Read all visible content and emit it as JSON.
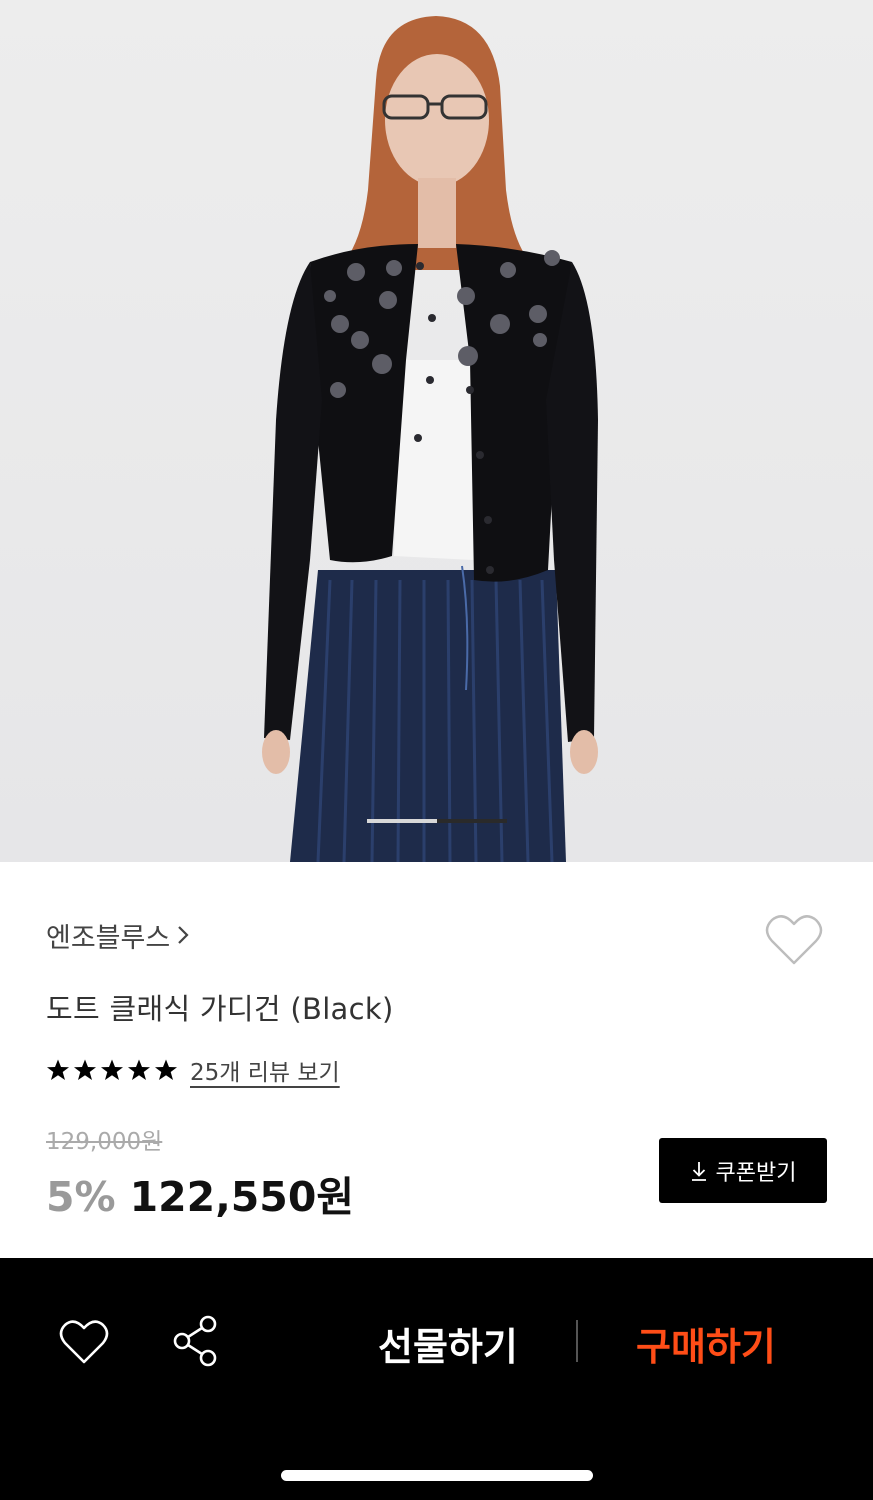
{
  "hero": {
    "image_alt": "",
    "carousel": {
      "active_index": 1,
      "total": 2
    }
  },
  "product": {
    "brand": "엔조블루스",
    "title": "도트 클래식 가디건 (Black)",
    "rating_stars": 5,
    "review_link": "25개 리뷰 보기",
    "original_price": "129,000원",
    "discount": "5%",
    "final_price": "122,550원"
  },
  "coupon": {
    "label": "쿠폰받기"
  },
  "bottom_bar": {
    "gift_label": "선물하기",
    "buy_label": "구매하기"
  },
  "colors": {
    "accent": "#ff4d17",
    "bar_background": "#000000"
  },
  "icons": [
    "heart-outline-icon",
    "chevron-right-icon",
    "star-icon",
    "download-icon",
    "share-icon"
  ]
}
